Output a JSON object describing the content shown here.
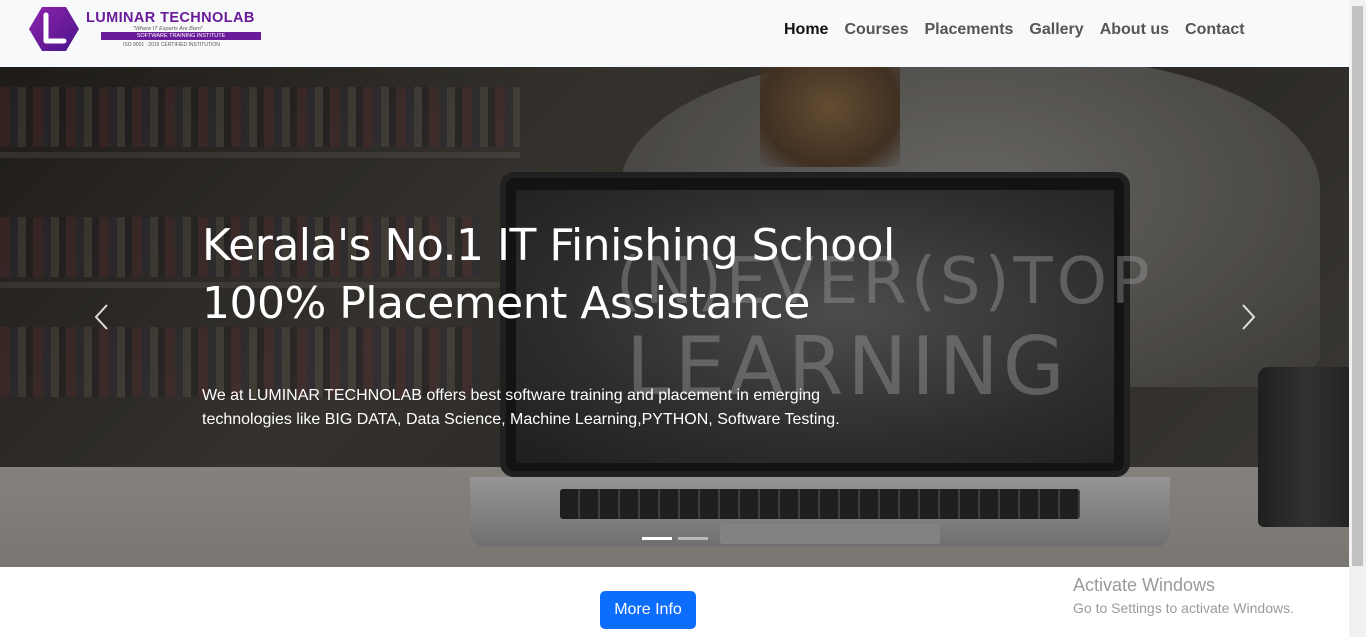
{
  "brand": {
    "name": "LUMINAR TECHNOLAB",
    "tagline": "\"Where IT Experts Are Born\"",
    "subtitle": "SOFTWARE TRAINING INSTITUTE",
    "certification": "ISO 9001 : 2015 CERTIFIED INSTITUTION",
    "logo_letter": "L",
    "color": "#6a1b9a"
  },
  "nav": {
    "items": [
      {
        "label": "Home",
        "active": true
      },
      {
        "label": "Courses"
      },
      {
        "label": "Placements"
      },
      {
        "label": "Gallery"
      },
      {
        "label": "About us"
      },
      {
        "label": "Contact"
      }
    ]
  },
  "hero": {
    "title_line1": "Kerala's No.1 IT Finishing School",
    "title_line2": "100% Placement Assistance",
    "description": "We at LUMINAR TECHNOLAB offers best software training and placement in emerging technologies like BIG DATA, Data Science, Machine Learning,PYTHON, Software Testing.",
    "image_text_line1": "(N)EVER(S)TOP",
    "image_text_line2": "LEARNING",
    "prev_icon": "chevron-left-icon",
    "next_icon": "chevron-right-icon",
    "indicators": 2,
    "active_indicator": 1
  },
  "cta": {
    "label": "More Info",
    "color": "#0d6efd"
  },
  "watermark": {
    "title": "Activate Windows",
    "subtitle": "Go to Settings to activate Windows."
  }
}
